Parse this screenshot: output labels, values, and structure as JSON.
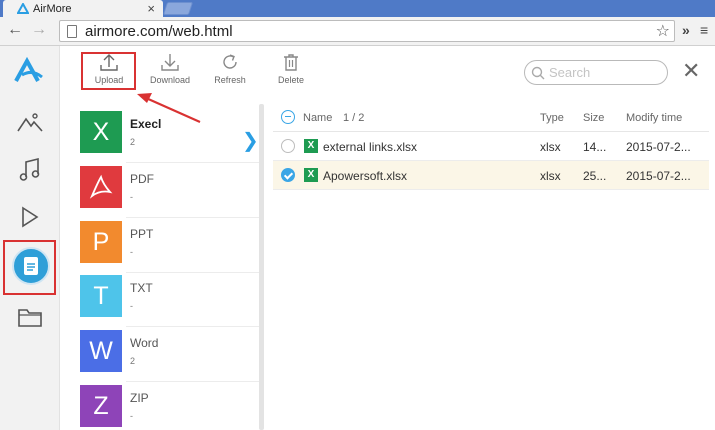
{
  "browser": {
    "tab_title": "AirMore",
    "tab_close": "×",
    "url": "airmore.com/web.html",
    "menu_chevron": "»"
  },
  "sidebar": {
    "items": [
      {
        "icon": "photos-icon"
      },
      {
        "icon": "music-icon"
      },
      {
        "icon": "video-icon"
      },
      {
        "icon": "documents-icon",
        "active": true
      },
      {
        "icon": "folder-icon"
      }
    ]
  },
  "toolbar": {
    "upload_label": "Upload",
    "download_label": "Download",
    "refresh_label": "Refresh",
    "delete_label": "Delete",
    "search_placeholder": "Search"
  },
  "categories": [
    {
      "name": "Execl",
      "count": "2",
      "letter": "X",
      "color": "#1e9b52",
      "active": true
    },
    {
      "name": "PDF",
      "count": "-",
      "letter": "",
      "color": "#e03a3e"
    },
    {
      "name": "PPT",
      "count": "-",
      "letter": "P",
      "color": "#f28a2e"
    },
    {
      "name": "TXT",
      "count": "-",
      "letter": "T",
      "color": "#4ec4ea"
    },
    {
      "name": "Word",
      "count": "2",
      "letter": "W",
      "color": "#4b6ee6"
    },
    {
      "name": "ZIP",
      "count": "-",
      "letter": "Z",
      "color": "#8e44b8"
    }
  ],
  "table": {
    "headers": {
      "name": "Name",
      "page": "1 / 2",
      "type": "Type",
      "size": "Size",
      "modified": "Modify time"
    },
    "rows": [
      {
        "name": "external links.xlsx",
        "type": "xlsx",
        "size": "14...",
        "modified": "2015-07-2...",
        "selected": false
      },
      {
        "name": "Apowersoft.xlsx",
        "type": "xlsx",
        "size": "25...",
        "modified": "2015-07-2...",
        "selected": true
      }
    ]
  },
  "colors": {
    "accent": "#2a9ee3",
    "highlight_box": "#d93232"
  }
}
